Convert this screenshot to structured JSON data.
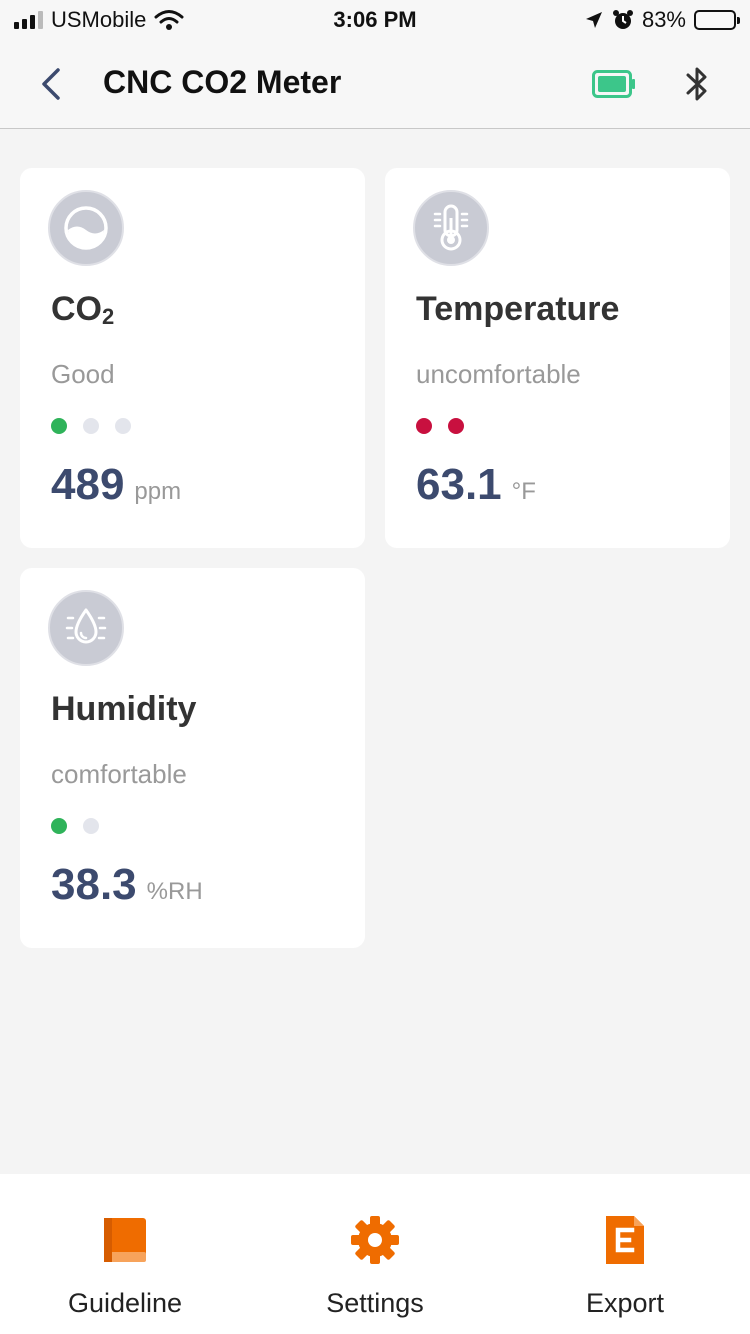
{
  "status_bar": {
    "carrier": "USMobile",
    "time": "3:06 PM",
    "battery_percent": "83%",
    "icons": [
      "signal-icon",
      "wifi-icon",
      "location-icon",
      "alarm-icon",
      "battery-icon"
    ]
  },
  "nav": {
    "title": "CNC CO2 Meter",
    "icons": [
      "back-icon",
      "device-battery-icon",
      "bluetooth-icon"
    ],
    "accent": "#3cc68a"
  },
  "cards": [
    {
      "icon": "co2-icon",
      "title": "CO",
      "title_sub": "2",
      "status": "Good",
      "dots": [
        "green",
        "gray",
        "gray"
      ],
      "value": "489",
      "unit": "ppm"
    },
    {
      "icon": "thermometer-icon",
      "title": "Temperature",
      "status": "uncomfortable",
      "dots": [
        "red",
        "red"
      ],
      "value": "63.1",
      "unit": "°F"
    },
    {
      "icon": "humidity-icon",
      "title": "Humidity",
      "status": "comfortable",
      "dots": [
        "green",
        "gray"
      ],
      "value": "38.3",
      "unit": "%RH"
    }
  ],
  "tabs": [
    {
      "label": "Guideline",
      "icon": "book-icon"
    },
    {
      "label": "Settings",
      "icon": "gear-icon"
    },
    {
      "label": "Export",
      "icon": "export-icon"
    }
  ],
  "colors": {
    "value_text": "#3c4a6e",
    "good": "#2fb35a",
    "bad": "#c8103f",
    "tab_icon": "#ef6c00"
  }
}
